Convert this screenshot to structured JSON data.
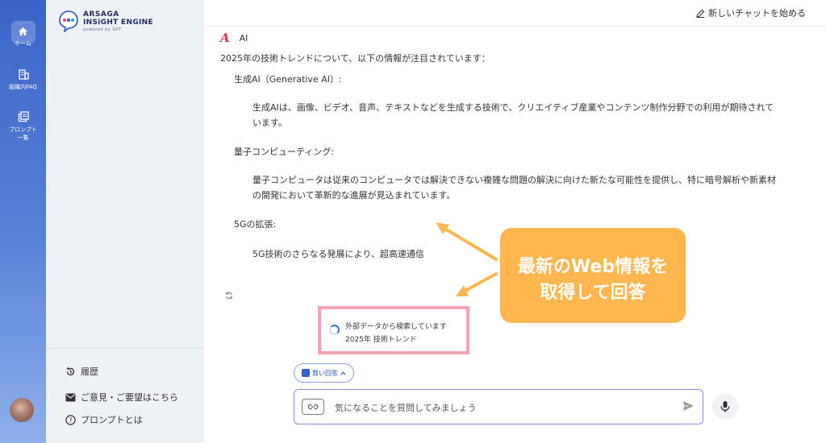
{
  "rail": {
    "home_label": "ホーム",
    "faq_label": "組織内FAQ",
    "prompts_label_line1": "プロンプト",
    "prompts_label_line2": "一覧"
  },
  "sidebar": {
    "logo_line1": "ARSAGA",
    "logo_line2": "INSiGHT ENGINE",
    "logo_line3": "powered by GPT",
    "history": "履歴",
    "feedback": "ご意見・ご要望はこちら",
    "about_prompt": "プロンプトとは"
  },
  "header": {
    "new_chat": "新しいチャットを始める"
  },
  "message": {
    "author": "AI",
    "intro": "2025年の技術トレンドについて、以下の情報が注目されています：",
    "items": [
      {
        "title": "生成AI（Generative AI）:",
        "body_line1": "生成AIは、画像、ビデオ、音声、テキストなどを生成する技術で、クリエイティブ産業やコンテンツ制作分野での利用が期待されて",
        "body_line2": "います。"
      },
      {
        "title": "量子コンピューティング:",
        "body_line1": "量子コンピュータは従来のコンピュータでは解決できない複雑な問題の解決に向けた新たな可能性を提供し、特に暗号解析や新素材",
        "body_line2": "の開発において革新的な進展が見込まれています。"
      },
      {
        "title": "5Gの拡張:",
        "body_line1": "5G技術のさらなる発展により、超高速通信",
        "body_line2": ""
      }
    ]
  },
  "search_status": {
    "line1": "外部データから検索しています",
    "line2": "2025年 技術トレンド"
  },
  "callout": {
    "line1": "最新のWeb情報を",
    "line2": "取得して回答"
  },
  "smart_answer": {
    "label": "賢い回答"
  },
  "composer": {
    "placeholder": "気になることを質問してみましょう"
  },
  "colors": {
    "accent": "#3a64c8",
    "callout": "#ffb64f",
    "highlight_border": "#f4a3b4",
    "ai_logo": "#e03048"
  }
}
